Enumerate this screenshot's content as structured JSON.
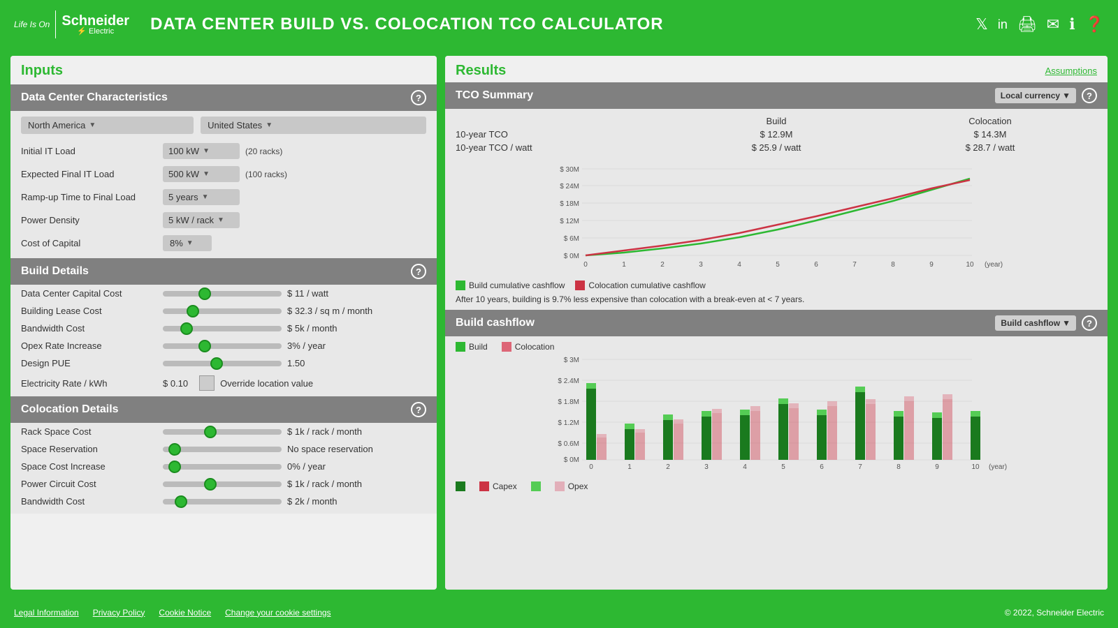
{
  "header": {
    "logo_life": "Life Is On",
    "logo_brand": "Schneider Electric",
    "title": "DATA CENTER BUILD VS. COLOCATION TCO CALCULATOR",
    "icons": [
      "twitter",
      "linkedin",
      "print",
      "email",
      "info",
      "help"
    ]
  },
  "inputs": {
    "section_title": "Inputs",
    "data_center": {
      "section_label": "Data Center Characteristics",
      "region": "North America",
      "country": "United States",
      "initial_it_load_label": "Initial IT Load",
      "initial_it_load_value": "100 kW",
      "initial_it_load_unit": "(20 racks)",
      "expected_final_it_load_label": "Expected Final IT Load",
      "expected_final_it_load_value": "500 kW",
      "expected_final_it_load_unit": "(100 racks)",
      "rampup_label": "Ramp-up Time to Final Load",
      "rampup_value": "5 years",
      "power_density_label": "Power Density",
      "power_density_value": "5 kW / rack",
      "cost_of_capital_label": "Cost of Capital",
      "cost_of_capital_value": "8%"
    },
    "build_details": {
      "section_label": "Build Details",
      "dc_capital_cost_label": "Data Center Capital Cost",
      "dc_capital_cost_value": "$ 11 / watt",
      "dc_capital_cost_pos": 0.35,
      "building_lease_label": "Building Lease Cost",
      "building_lease_value": "$ 32.3 / sq m / month",
      "building_lease_pos": 0.25,
      "bandwidth_label": "Bandwidth Cost",
      "bandwidth_value": "$ 5k / month",
      "bandwidth_pos": 0.2,
      "opex_label": "Opex Rate Increase",
      "opex_value": "3% / year",
      "opex_pos": 0.35,
      "design_pue_label": "Design PUE",
      "design_pue_value": "1.50",
      "design_pue_pos": 0.45,
      "electricity_label": "Electricity Rate / kWh",
      "electricity_value": "$ 0.10",
      "override_label": "Override location value"
    },
    "colocation_details": {
      "section_label": "Colocation Details",
      "rack_space_label": "Rack Space Cost",
      "rack_space_value": "$ 1k  / rack / month",
      "rack_space_pos": 0.4,
      "space_reservation_label": "Space Reservation",
      "space_reservation_value": "No space reservation",
      "space_reservation_pos": 0.1,
      "space_cost_increase_label": "Space Cost Increase",
      "space_cost_increase_value": "0% / year",
      "space_cost_increase_pos": 0.1,
      "power_circuit_label": "Power Circuit Cost",
      "power_circuit_value": "$ 1k  / rack / month",
      "power_circuit_pos": 0.4,
      "bandwidth_label": "Bandwidth Cost",
      "bandwidth_value": "$ 2k / month",
      "bandwidth_pos": 0.15
    }
  },
  "results": {
    "section_title": "Results",
    "assumptions_label": "Assumptions",
    "tco_summary": {
      "section_label": "TCO Summary",
      "currency_btn": "Local currency",
      "col_build": "Build",
      "col_colo": "Colocation",
      "row1_label": "10-year TCO",
      "row1_build": "$ 12.9M",
      "row1_colo": "$ 14.3M",
      "row2_label": "10-year TCO / watt",
      "row2_build": "$ 25.9 / watt",
      "row2_colo": "$ 28.7 / watt",
      "chart_note": "After 10 years, building is 9.7% less expensive than colocation with a break-even at < 7 years.",
      "y_axis": [
        "$ 30M",
        "$ 24M",
        "$ 18M",
        "$ 12M",
        "$ 6M",
        "$ 0M"
      ],
      "x_axis": [
        "0",
        "1",
        "2",
        "3",
        "4",
        "5",
        "6",
        "7",
        "8",
        "9",
        "10"
      ],
      "x_label": "(year)",
      "legend_build": "Build cumulative cashflow",
      "legend_colo": "Colocation cumulative cashflow"
    },
    "build_cashflow": {
      "section_label": "Build cashflow",
      "dropdown_label": "Build cashflow",
      "legend_build": "Build",
      "legend_colo": "Colocation",
      "legend_capex": "Capex",
      "legend_opex": "Opex",
      "y_axis": [
        "$ 3M",
        "$ 2.4M",
        "$ 1.8M",
        "$ 1.2M",
        "$ 0.6M",
        "$ 0M"
      ],
      "x_axis": [
        "0",
        "1",
        "2",
        "3",
        "4",
        "5",
        "6",
        "7",
        "8",
        "9",
        "10"
      ],
      "x_label": "(year)"
    }
  },
  "footer": {
    "links": [
      "Legal Information",
      "Privacy Policy",
      "Cookie Notice",
      "Change your cookie settings"
    ],
    "copyright": "© 2022, Schneider Electric"
  }
}
